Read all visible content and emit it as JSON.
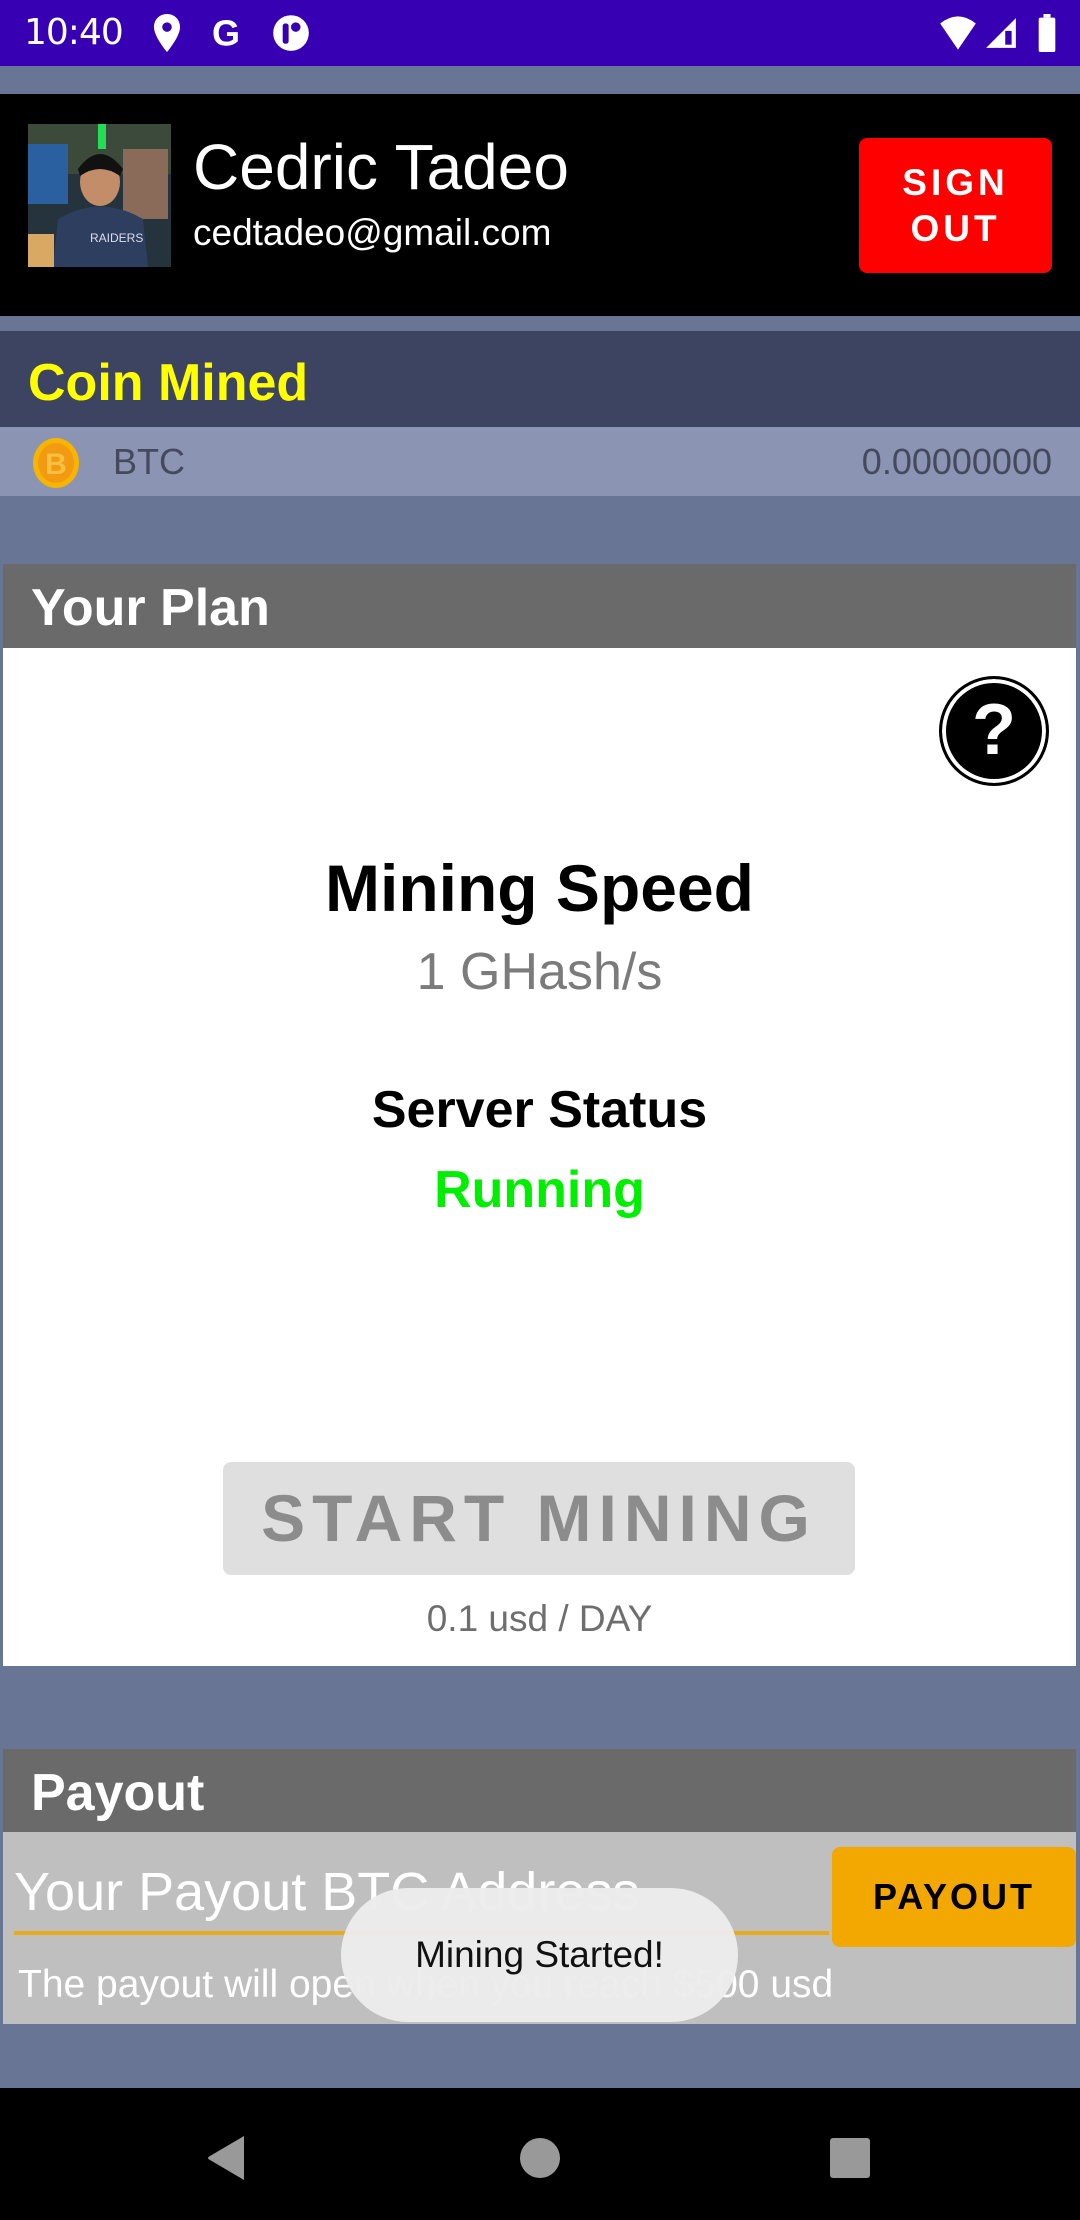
{
  "status_bar": {
    "time": "10:40",
    "left_icons": [
      "location-pin-icon",
      "google-icon",
      "app-notification-icon"
    ],
    "right_icons": [
      "wifi-icon",
      "cell-signal-icon",
      "battery-icon"
    ]
  },
  "header": {
    "avatar_alt": "Profile photo",
    "name": "Cedric Tadeo",
    "email": "cedtadeo@gmail.com",
    "sign_out_label": "SIGN OUT"
  },
  "coin_mined": {
    "title": "Coin Mined",
    "coins": [
      {
        "icon": "bitcoin-icon",
        "symbol": "BTC",
        "amount": "0.00000000"
      }
    ]
  },
  "plan": {
    "title": "Your Plan",
    "help_label": "?",
    "speed_title": "Mining Speed",
    "speed_value": "1 GHash/s",
    "server_status_title": "Server Status",
    "server_status_value": "Running",
    "start_button_label": "START MINING",
    "rate": "0.1 usd / DAY"
  },
  "payout": {
    "title": "Payout",
    "address_placeholder": "Your Payout BTC Address",
    "address_value": "",
    "button_label": "PAYOUT",
    "note": "The payout will open when you reach $500 usd"
  },
  "toast": {
    "message": "Mining Started!"
  },
  "colors": {
    "status_bar": "#3700b3",
    "background": "#687594",
    "sign_out": "#fe0000",
    "coin_title": "#ffff00",
    "running": "#00ee00",
    "payout_button": "#f2a800"
  },
  "navbar": {
    "buttons": [
      "back",
      "home",
      "recents"
    ]
  }
}
